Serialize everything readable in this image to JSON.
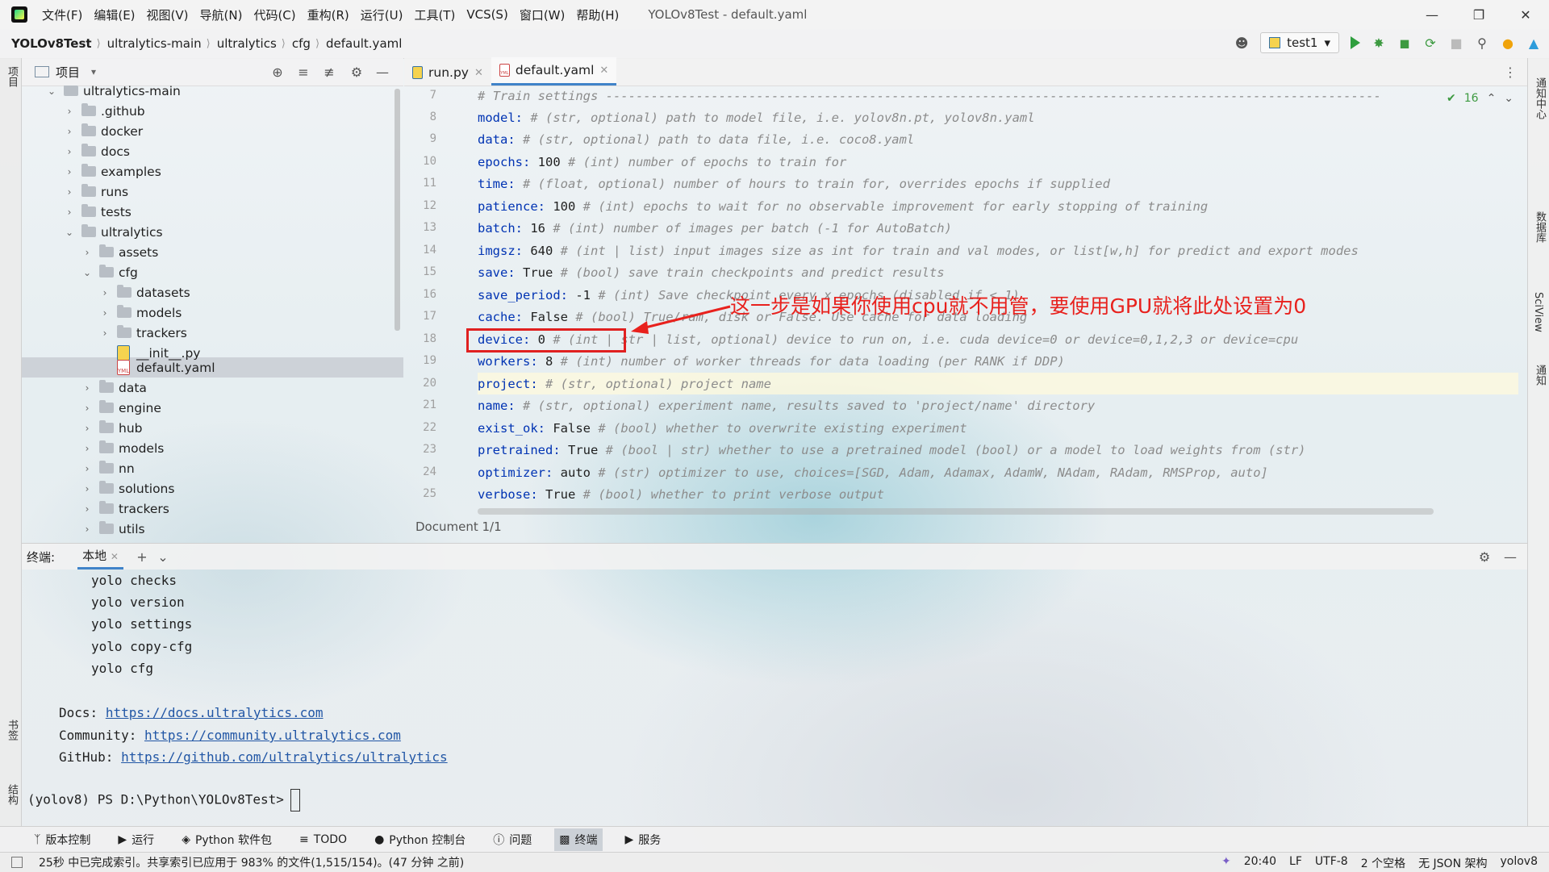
{
  "menubar": {
    "items": [
      "文件(F)",
      "编辑(E)",
      "视图(V)",
      "导航(N)",
      "代码(C)",
      "重构(R)",
      "运行(U)",
      "工具(T)",
      "VCS(S)",
      "窗口(W)",
      "帮助(H)"
    ],
    "title": "YOLOv8Test - default.yaml"
  },
  "breadcrumb": [
    "YOLOv8Test",
    "ultralytics-main",
    "ultralytics",
    "cfg",
    "default.yaml"
  ],
  "run_config": "test1",
  "project_panel": {
    "title": "项目",
    "rows": [
      {
        "label": "ultralytics-main",
        "kind": "folder",
        "open": true
      },
      {
        "label": ".github",
        "kind": "folder"
      },
      {
        "label": "docker",
        "kind": "folder"
      },
      {
        "label": "docs",
        "kind": "folder"
      },
      {
        "label": "examples",
        "kind": "folder"
      },
      {
        "label": "runs",
        "kind": "folder"
      },
      {
        "label": "tests",
        "kind": "folder"
      },
      {
        "label": "ultralytics",
        "kind": "folder",
        "open": true
      },
      {
        "label": "assets",
        "kind": "folder"
      },
      {
        "label": "cfg",
        "kind": "folder",
        "open": true
      },
      {
        "label": "datasets",
        "kind": "folder"
      },
      {
        "label": "models",
        "kind": "folder"
      },
      {
        "label": "trackers",
        "kind": "folder"
      },
      {
        "label": "__init__.py",
        "kind": "py"
      },
      {
        "label": "default.yaml",
        "kind": "yml",
        "selected": true
      },
      {
        "label": "data",
        "kind": "folder"
      },
      {
        "label": "engine",
        "kind": "folder"
      },
      {
        "label": "hub",
        "kind": "folder"
      },
      {
        "label": "models",
        "kind": "folder"
      },
      {
        "label": "nn",
        "kind": "folder"
      },
      {
        "label": "solutions",
        "kind": "folder"
      },
      {
        "label": "trackers",
        "kind": "folder"
      },
      {
        "label": "utils",
        "kind": "folder"
      }
    ]
  },
  "editor_tabs": [
    {
      "label": "run.py",
      "active": false
    },
    {
      "label": "default.yaml",
      "active": true
    }
  ],
  "inspection": "16",
  "code_lines": [
    {
      "n": "7",
      "key": "",
      "val": "",
      "comment": "# Train settings -------------------------------------------------------------------------------------------------------"
    },
    {
      "n": "8",
      "key": "model:",
      "val": " ",
      "comment": "# (str, optional) path to model file, i.e. yolov8n.pt, yolov8n.yaml"
    },
    {
      "n": "9",
      "key": "data:",
      "val": " ",
      "comment": "# (str, optional) path to data file, i.e. coco8.yaml"
    },
    {
      "n": "10",
      "key": "epochs:",
      "val": " 100 ",
      "comment": "# (int) number of epochs to train for"
    },
    {
      "n": "11",
      "key": "time:",
      "val": " ",
      "comment": "# (float, optional) number of hours to train for, overrides epochs if supplied"
    },
    {
      "n": "12",
      "key": "patience:",
      "val": " 100 ",
      "comment": "# (int) epochs to wait for no observable improvement for early stopping of training"
    },
    {
      "n": "13",
      "key": "batch:",
      "val": " 16 ",
      "comment": "# (int) number of images per batch (-1 for AutoBatch)"
    },
    {
      "n": "14",
      "key": "imgsz:",
      "val": " 640 ",
      "comment": "# (int | list) input images size as int for train and val modes, or list[w,h] for predict and export modes"
    },
    {
      "n": "15",
      "key": "save:",
      "val": " True ",
      "comment": "# (bool) save train checkpoints and predict results"
    },
    {
      "n": "16",
      "key": "save_period:",
      "val": " -1 ",
      "comment": "# (int) Save checkpoint every x epochs (disabled if < 1)"
    },
    {
      "n": "17",
      "key": "cache:",
      "val": " False ",
      "comment": "# (bool) True/ram, disk or False. Use cache for data loading"
    },
    {
      "n": "18",
      "key": "device:",
      "val": " 0 ",
      "comment": "# (int | str | list, optional) device to run on, i.e. cuda device=0 or device=0,1,2,3 or device=cpu"
    },
    {
      "n": "19",
      "key": "workers:",
      "val": " 8 ",
      "comment": "# (int) number of worker threads for data loading (per RANK if DDP)"
    },
    {
      "n": "20",
      "key": "project:",
      "val": " ",
      "comment": "# (str, optional) project name"
    },
    {
      "n": "21",
      "key": "name:",
      "val": " ",
      "comment": "# (str, optional) experiment name, results saved to 'project/name' directory"
    },
    {
      "n": "22",
      "key": "exist_ok:",
      "val": " False ",
      "comment": "# (bool) whether to overwrite existing experiment"
    },
    {
      "n": "23",
      "key": "pretrained:",
      "val": " True ",
      "comment": "# (bool | str) whether to use a pretrained model (bool) or a model to load weights from (str)"
    },
    {
      "n": "24",
      "key": "optimizer:",
      "val": " auto ",
      "comment": "# (str) optimizer to use, choices=[SGD, Adam, Adamax, AdamW, NAdam, RAdam, RMSProp, auto]"
    },
    {
      "n": "25",
      "key": "verbose:",
      "val": " True ",
      "comment": "# (bool) whether to print verbose output"
    }
  ],
  "annotation": "这一步是如果你使用cpu就不用管，要使用GPU就将此处设置为0",
  "doc_status": "Document 1/1",
  "terminal": {
    "label": "终端:",
    "tab": "本地",
    "lines": [
      "yolo checks",
      "yolo version",
      "yolo settings",
      "yolo copy-cfg",
      "yolo cfg"
    ],
    "docs_label": "Docs:",
    "docs_url": "https://docs.ultralytics.com",
    "community_label": "Community:",
    "community_url": "https://community.ultralytics.com",
    "github_label": "GitHub:",
    "github_url": "https://github.com/ultralytics/ultralytics",
    "prompt": "(yolov8) PS D:\\Python\\YOLOv8Test>"
  },
  "tool_windows": [
    "版本控制",
    "运行",
    "Python 软件包",
    "TODO",
    "Python 控制台",
    "问题",
    "终端",
    "服务"
  ],
  "status": {
    "message": "25秒 中已完成索引。共享索引已应用于 983% 的文件(1,515/154)。(47 分钟 之前)",
    "time": "20:40",
    "line_sep": "LF",
    "encoding": "UTF-8",
    "indent": "2 个空格",
    "schema": "无 JSON 架构",
    "interpreter": "yolov8"
  },
  "left_strip": {
    "project": "项目",
    "bookmarks": "书签",
    "structure": "结构"
  },
  "right_strip": [
    "通知中心",
    "数据库",
    "SciView",
    "通知"
  ],
  "colors": {
    "key": "#0033b3",
    "comment": "#8c8c8c",
    "annotation": "#e8211d",
    "accent": "#4083c9"
  }
}
